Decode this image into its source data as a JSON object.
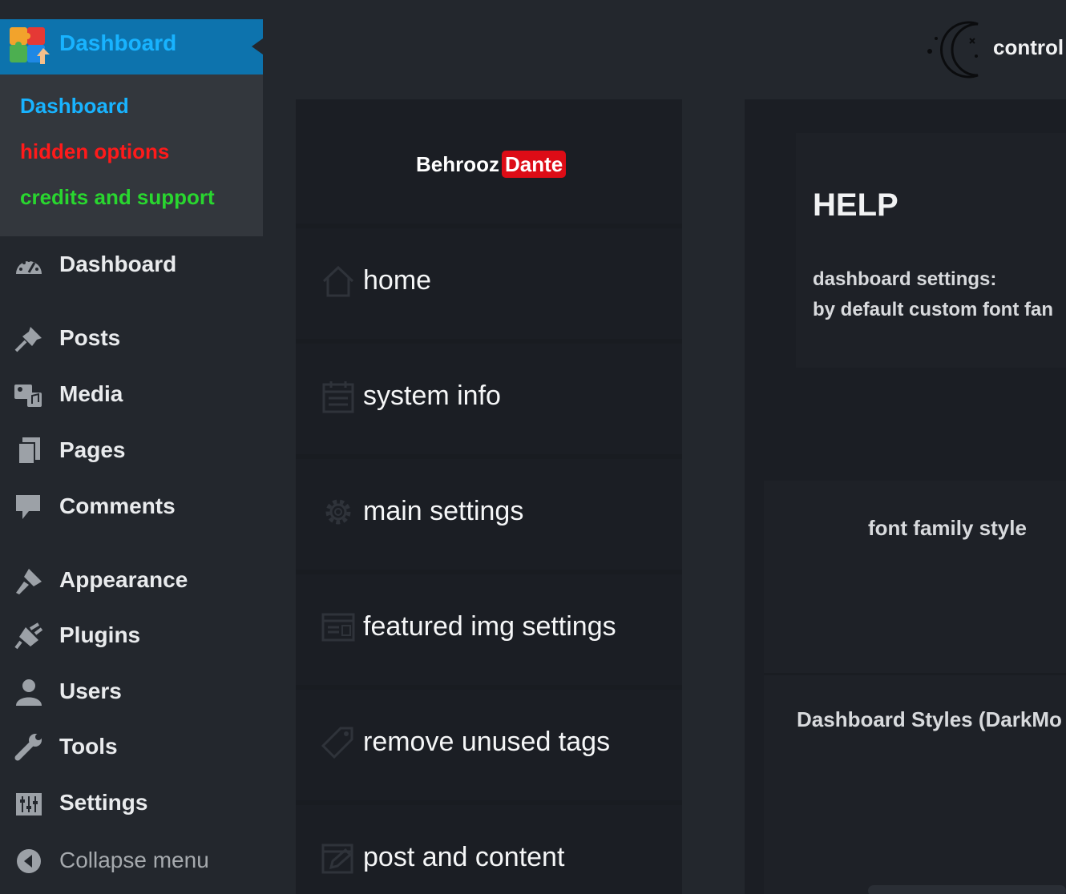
{
  "colors": {
    "background": "#23272d",
    "submenu_bg": "#33373d",
    "highlight_bar": "#0d73ad",
    "link_blue": "#18b3ff",
    "red_option": "#ff1a1a",
    "green_option": "#29d62f",
    "panel_bg": "#1b1e24",
    "brand_red": "#dd0c16"
  },
  "sidebar": {
    "plugin_head": {
      "label": "Dashboard",
      "icon": "puzzle-logo-icon"
    },
    "submenu": [
      {
        "label": "Dashboard",
        "color": "#18b3ff"
      },
      {
        "label": "hidden options",
        "color": "#ff1a1a"
      },
      {
        "label": "credits and support",
        "color": "#29d62f"
      }
    ],
    "items": [
      {
        "label": "Dashboard",
        "icon": "gauge-icon"
      },
      {
        "label": "Posts",
        "icon": "pushpin-icon"
      },
      {
        "label": "Media",
        "icon": "media-icon"
      },
      {
        "label": "Pages",
        "icon": "pages-icon"
      },
      {
        "label": "Comments",
        "icon": "comment-icon"
      },
      {
        "label": "Appearance",
        "icon": "paintbrush-icon"
      },
      {
        "label": "Plugins",
        "icon": "plug-icon"
      },
      {
        "label": "Users",
        "icon": "user-icon"
      },
      {
        "label": "Tools",
        "icon": "wrench-icon"
      },
      {
        "label": "Settings",
        "icon": "sliders-icon"
      },
      {
        "label": "Collapse menu",
        "icon": "collapse-arrow-icon"
      }
    ]
  },
  "topbar": {
    "mode_toggle_label": "control",
    "mode_icon": "moon-icon"
  },
  "plugin_nav": {
    "brand_first": "Behrooz",
    "brand_second": "Dante",
    "items": [
      {
        "label": "home",
        "icon": "home-icon"
      },
      {
        "label": "system info",
        "icon": "calendar-icon"
      },
      {
        "label": "main settings",
        "icon": "gear-icon"
      },
      {
        "label": "featured img settings",
        "icon": "image-settings-icon"
      },
      {
        "label": "remove unused tags",
        "icon": "tag-icon"
      },
      {
        "label": "post and content",
        "icon": "edit-icon"
      }
    ]
  },
  "help_card": {
    "title": "HELP",
    "line1": "dashboard settings:",
    "line2": "by default custom font fan"
  },
  "styles_card": {
    "font_family_title": "font family style",
    "dashboard_styles_title": "Dashboard Styles (DarkMo"
  }
}
